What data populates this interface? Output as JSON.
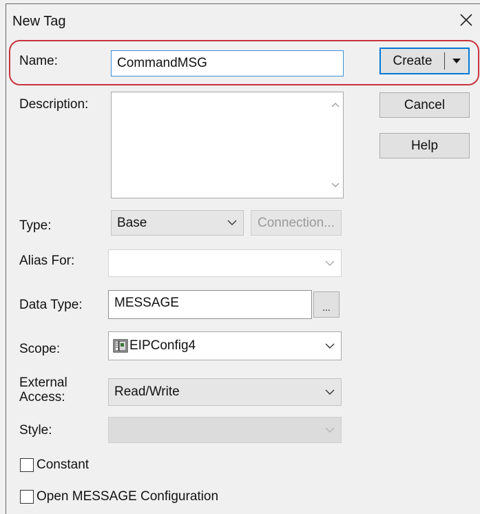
{
  "window": {
    "title": "New Tag",
    "close_icon": "close-icon"
  },
  "form": {
    "name": {
      "label": "Name:",
      "value": "CommandMSG"
    },
    "description": {
      "label": "Description:",
      "value": ""
    },
    "type": {
      "label": "Type:",
      "value": "Base",
      "connection_button": "Connection..."
    },
    "alias_for": {
      "label": "Alias For:",
      "value": ""
    },
    "data_type": {
      "label": "Data Type:",
      "value": "MESSAGE",
      "browse_button": "..."
    },
    "scope": {
      "label": "Scope:",
      "value": "EIPConfig4",
      "icon": "controller-icon"
    },
    "external_access": {
      "label_line1": "External",
      "label_line2": "Access:",
      "value": "Read/Write"
    },
    "style": {
      "label": "Style:",
      "value": ""
    },
    "constant": {
      "label": "Constant",
      "checked": false
    },
    "open_config": {
      "label": "Open MESSAGE Configuration",
      "checked": false
    }
  },
  "buttons": {
    "create": "Create",
    "cancel": "Cancel",
    "help": "Help"
  },
  "colors": {
    "highlight": "#c8323c",
    "focus_border": "#3b8fd8",
    "default_button_border": "#0078d7"
  }
}
